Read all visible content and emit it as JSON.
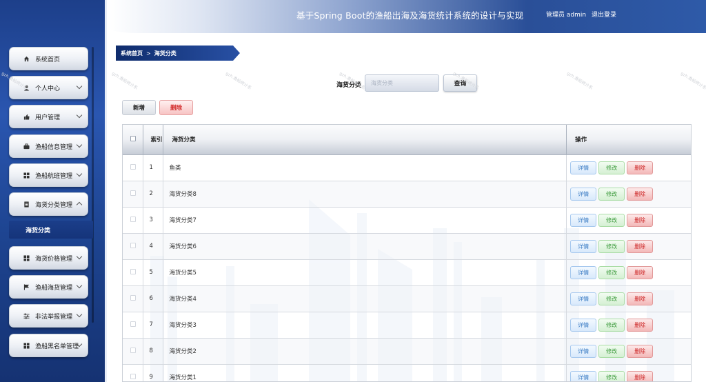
{
  "header": {
    "title": "基于Spring Boot的渔船出海及海货统计系统的设计与实现",
    "user": "管理员 admin",
    "logout": "退出登录"
  },
  "sidebar": {
    "items": [
      {
        "label": "系统首页",
        "icon": "home-icon",
        "expandable": false
      },
      {
        "label": "个人中心",
        "icon": "user-icon",
        "expandable": true
      },
      {
        "label": "用户管理",
        "icon": "thumbs-up-icon",
        "expandable": true
      },
      {
        "label": "渔船信息管理",
        "icon": "briefcase-icon",
        "expandable": true
      },
      {
        "label": "渔船航班管理",
        "icon": "grid-icon",
        "expandable": true
      },
      {
        "label": "海货分类管理",
        "icon": "document-icon",
        "expandable": true,
        "expanded": true
      },
      {
        "label": "海货价格管理",
        "icon": "grid-icon",
        "expandable": true
      },
      {
        "label": "渔船海货管理",
        "icon": "flag-icon",
        "expandable": true
      },
      {
        "label": "非法举报管理",
        "icon": "sliders-icon",
        "expandable": true
      },
      {
        "label": "渔船黑名单管理",
        "icon": "grid-icon",
        "expandable": true
      }
    ],
    "submenu": {
      "label": "海货分类"
    }
  },
  "breadcrumb": {
    "home": "系统首页",
    "separator": ">",
    "current": "海货分类"
  },
  "search": {
    "label": "海货分类",
    "placeholder": "海货分类",
    "button": "查询"
  },
  "actions": {
    "add": "新增",
    "delete": "删除"
  },
  "table": {
    "headers": {
      "index": "索引",
      "category": "海货分类",
      "operations": "操作"
    },
    "row_actions": {
      "detail": "详情",
      "edit": "修改",
      "delete": "删除"
    },
    "rows": [
      {
        "index": "1",
        "category": "鱼类"
      },
      {
        "index": "2",
        "category": "海货分类8"
      },
      {
        "index": "3",
        "category": "海货分类7"
      },
      {
        "index": "4",
        "category": "海货分类6"
      },
      {
        "index": "5",
        "category": "海货分类5"
      },
      {
        "index": "6",
        "category": "海货分类4"
      },
      {
        "index": "7",
        "category": "海货分类3"
      },
      {
        "index": "8",
        "category": "海货分类2"
      },
      {
        "index": "9",
        "category": "海货分类1"
      }
    ]
  },
  "colors": {
    "sidebar": "#1e4592",
    "header_dark": "#2a4f98",
    "danger": "#d32f2f",
    "edit": "#3b9a3b",
    "detail": "#3b7cc4"
  }
}
